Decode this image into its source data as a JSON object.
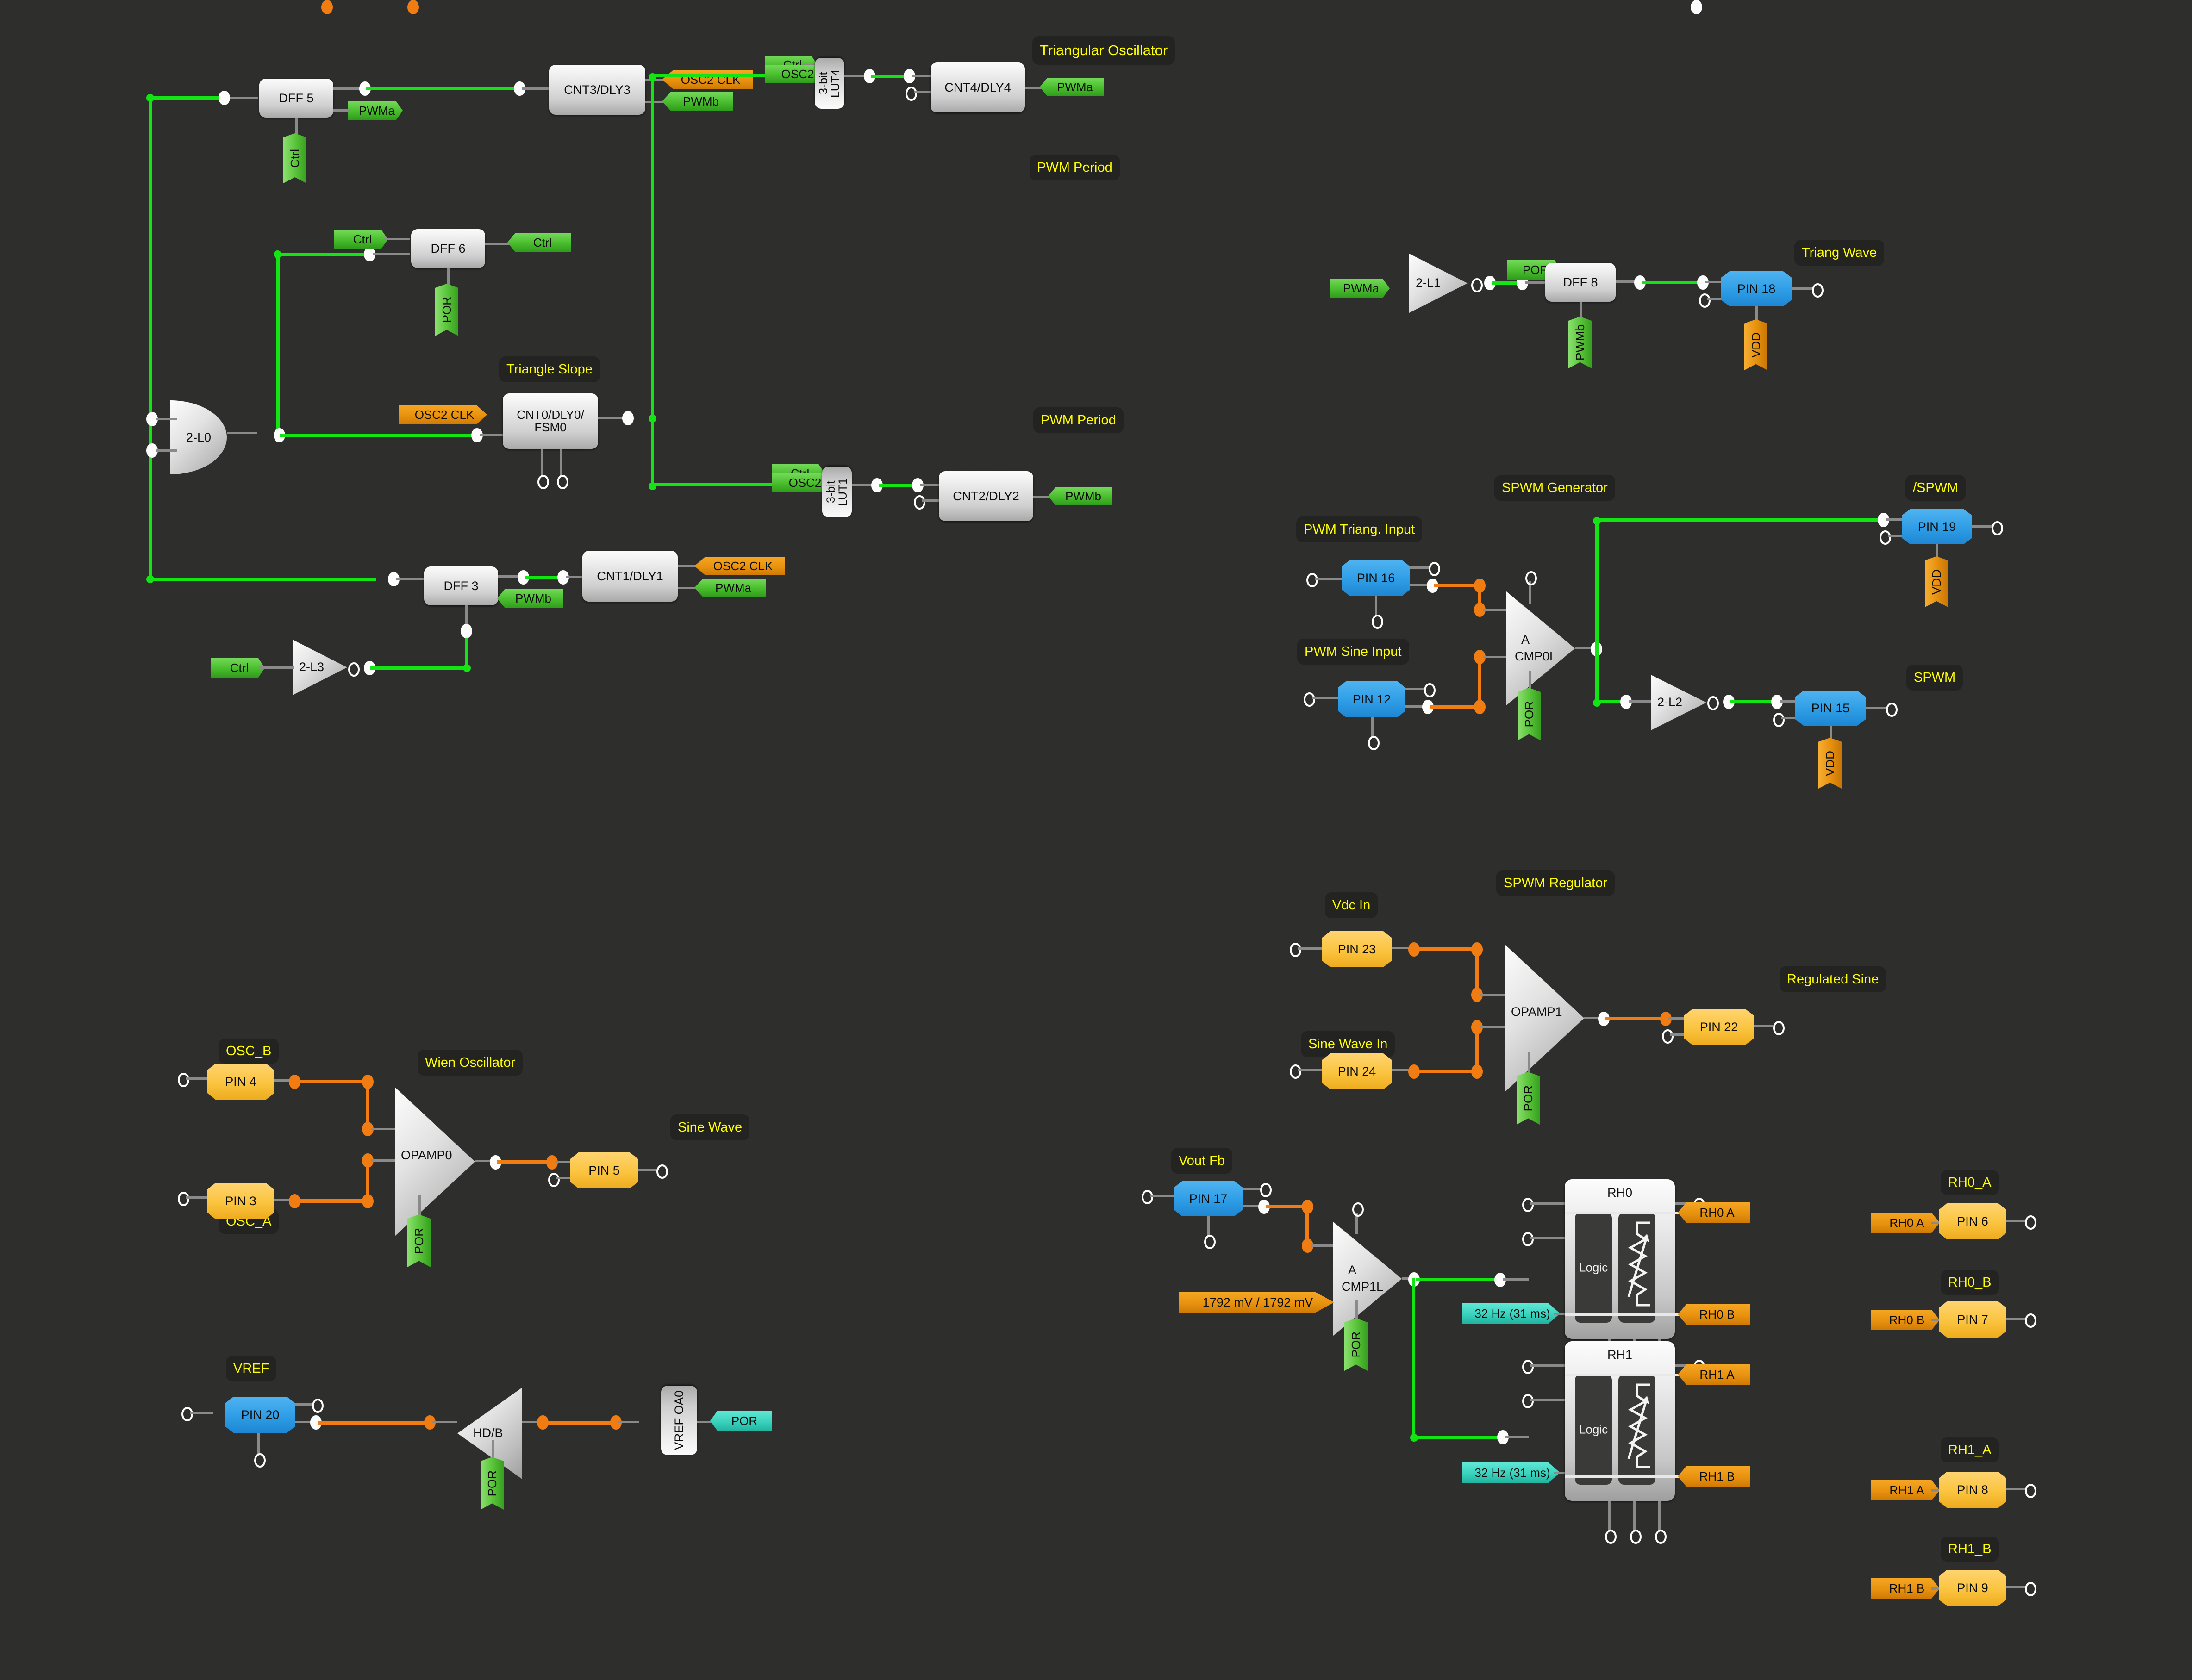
{
  "titles": {
    "triangular_oscillator": "Triangular Oscillator",
    "triangle_slope": "Triangle Slope",
    "pwm_period_top": "PWM Period",
    "pwm_period_bottom": "PWM Period",
    "triang_wave": "Triang Wave",
    "spwm_generator": "SPWM Generator",
    "spwm_not": "/SPWM",
    "spwm": "SPWM",
    "pwm_triang_input": "PWM Triang. Input",
    "pwm_sine_input": "PWM Sine Input",
    "spwm_regulator": "SPWM Regulator",
    "vdc_in": "Vdc In",
    "sine_wave_in": "Sine Wave In",
    "regulated_sine": "Regulated Sine",
    "vout_fb": "Vout Fb",
    "wien_oscillator": "Wien Oscillator",
    "osc_b": "OSC_B",
    "osc_a": "OSC_A",
    "sine_wave": "Sine Wave",
    "vref": "VREF",
    "rh0_a": "RH0_A",
    "rh0_b": "RH0_B",
    "rh1_a": "RH1_A",
    "rh1_b": "RH1_B"
  },
  "blocks": {
    "dff5": "DFF 5",
    "dff6": "DFF 6",
    "dff3": "DFF 3",
    "dff8": "DFF 8",
    "cnt3": "CNT3/DLY3",
    "cnt4": "CNT4/DLY4",
    "cnt2": "CNT2/DLY2",
    "cnt1": "CNT1/DLY1",
    "cnt0": "CNT0/DLY0/ FSM0",
    "lut4": "3-bit LUT4",
    "lut1": "3-bit LUT1",
    "vref_oa0": "VREF OA0",
    "rh0": "RH0",
    "rh1": "RH1",
    "rh_logic": "Logic"
  },
  "gates": {
    "or_2l0": "2-L0",
    "buf_2l1": "2-L1",
    "buf_2l2": "2-L2",
    "buf_2l3": "2-L3",
    "opamp0": "OPAMP0",
    "opamp1": "OPAMP1",
    "cmp0l_a": "A",
    "cmp0l": "CMP0L",
    "cmp1l_a": "A",
    "cmp1l": "CMP1L",
    "hdb": "HD/B"
  },
  "pins": {
    "pin3": "PIN 3",
    "pin4": "PIN 4",
    "pin5": "PIN 5",
    "pin6": "PIN 6",
    "pin7": "PIN 7",
    "pin8": "PIN 8",
    "pin9": "PIN 9",
    "pin12": "PIN 12",
    "pin15": "PIN 15",
    "pin16": "PIN 16",
    "pin17": "PIN 17",
    "pin18": "PIN 18",
    "pin19": "PIN 19",
    "pin20": "PIN 20",
    "pin22": "PIN 22",
    "pin23": "PIN 23",
    "pin24": "PIN 24"
  },
  "flags": {
    "pwma": "PWMa",
    "pwmb": "PWMb",
    "ctrl": "Ctrl",
    "por": "POR",
    "osc2": "OSC2",
    "osc2_clk": "OSC2 CLK",
    "vdd": "VDD",
    "rh0_a": "RH0 A",
    "rh0_b": "RH0 B",
    "rh1_a": "RH1 A",
    "rh1_b": "RH1 B",
    "freq_rh0": "32 Hz (31 ms)",
    "freq_rh1": "32 Hz (31 ms)",
    "cmp1l_threshold": "1792 mV / 1792 mV"
  },
  "colors": {
    "background": "#2e2e2c",
    "wire_gray": "#8a8a8a",
    "wire_green": "#13e413",
    "wire_orange": "#f07c12",
    "title_text": "#ffff00",
    "pin_blue": "#2e9de6",
    "pin_yellow": "#fbc43f",
    "flag_green": "#4cc030",
    "flag_orange": "#e8920f",
    "flag_teal": "#3ad2bd"
  }
}
